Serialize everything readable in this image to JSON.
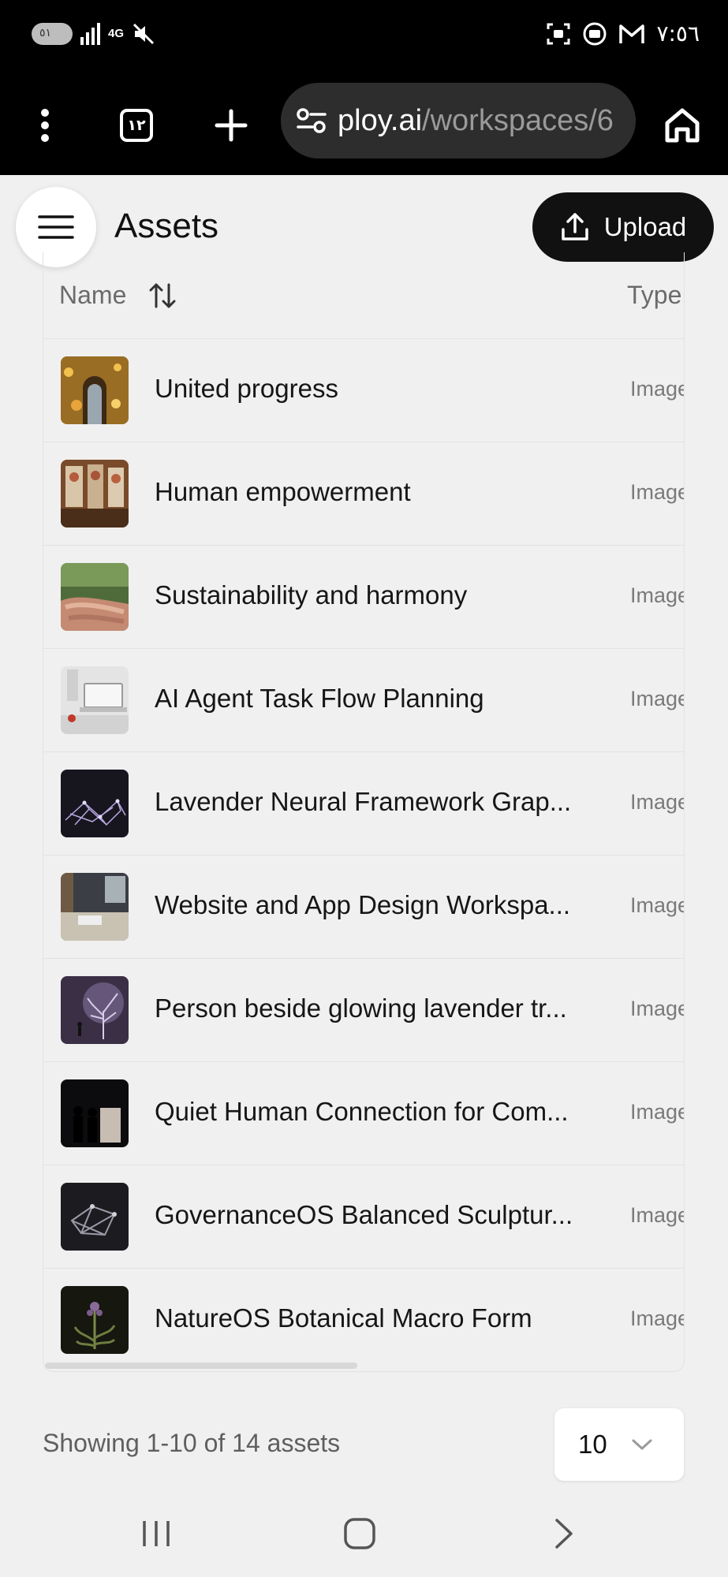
{
  "status_bar": {
    "toggle_text": "٥١",
    "network": "4G",
    "time": "٧:٥٦"
  },
  "browser": {
    "tab_count": "١٢",
    "url_host": "ploy.ai",
    "url_path": "/workspaces/6"
  },
  "header": {
    "title": "Assets",
    "upload_label": "Upload"
  },
  "table": {
    "columns": {
      "name": "Name",
      "type": "Type"
    },
    "rows": [
      {
        "name": "United progress",
        "type": "Image"
      },
      {
        "name": "Human empowerment",
        "type": "Image"
      },
      {
        "name": "Sustainability and harmony",
        "type": "Image"
      },
      {
        "name": "AI Agent Task Flow Planning",
        "type": "Image"
      },
      {
        "name": "Lavender Neural Framework Grap...",
        "type": "Image"
      },
      {
        "name": "Website and App Design Workspa...",
        "type": "Image"
      },
      {
        "name": "Person beside glowing lavender tr...",
        "type": "Image"
      },
      {
        "name": "Quiet Human Connection for Com...",
        "type": "Image"
      },
      {
        "name": "GovernanceOS Balanced Sculptur...",
        "type": "Image"
      },
      {
        "name": "NatureOS Botanical Macro Form",
        "type": "Image"
      }
    ]
  },
  "footer": {
    "showing_text": "Showing 1-10 of 14 assets",
    "per_page": "10"
  },
  "icons": {
    "menu": "hamburger-menu-icon",
    "upload": "upload-icon",
    "sort": "sort-arrows-icon",
    "dropdown": "chevron-down-icon"
  }
}
